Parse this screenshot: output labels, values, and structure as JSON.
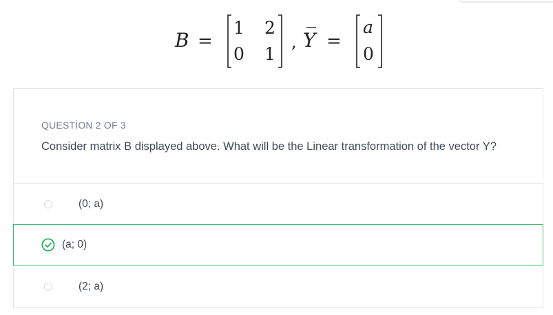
{
  "formula": {
    "lhs_matrix_name": "B",
    "equals": "=",
    "matrix_B": [
      [
        "1",
        "2"
      ],
      [
        "0",
        "1"
      ]
    ],
    "comma": ",",
    "rhs_vector_name": "Y",
    "vector_Y": [
      "a",
      "0"
    ]
  },
  "question": {
    "label": "QUESTİON 2 OF 3",
    "text": "Consider matrix B displayed above. What will be the Linear transformation of the vector Y?"
  },
  "options": [
    {
      "label": "(0; a)",
      "selected": false
    },
    {
      "label": "(a; 0)",
      "selected": true
    },
    {
      "label": "(2; a)",
      "selected": false
    }
  ],
  "colors": {
    "selected_border": "#3dbb6f",
    "check_icon": "#22b35e"
  }
}
